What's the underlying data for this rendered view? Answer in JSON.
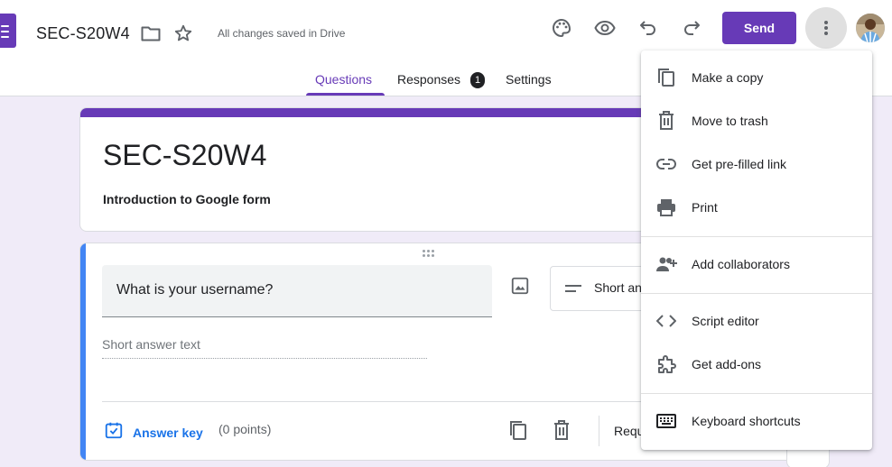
{
  "header": {
    "doc_title": "SEC-S20W4",
    "save_status": "All changes saved in Drive",
    "send_label": "Send",
    "icons": [
      "forms-logo-icon",
      "folder-icon",
      "star-icon",
      "palette-icon",
      "preview-eye-icon",
      "undo-icon",
      "redo-icon",
      "more-vert-icon",
      "avatar"
    ]
  },
  "tabs": {
    "questions": "Questions",
    "responses": "Responses",
    "responses_badge": "1",
    "settings": "Settings",
    "active": "Questions"
  },
  "form": {
    "title": "SEC-S20W4",
    "description": "Introduction to Google form"
  },
  "question": {
    "text": "What is your username?",
    "type": "Short answer",
    "answer_placeholder": "Short answer text",
    "answer_key_label": "Answer key",
    "points": "(0 points)",
    "required_label": "Required"
  },
  "menu": {
    "items": [
      {
        "label": "Make a copy",
        "icon": "copy-icon"
      },
      {
        "label": "Move to trash",
        "icon": "trash-icon"
      },
      {
        "label": "Get pre-filled link",
        "icon": "link-icon"
      },
      {
        "label": "Print",
        "icon": "print-icon"
      },
      {
        "label": "Add collaborators",
        "icon": "add-people-icon"
      },
      {
        "label": "Script editor",
        "icon": "code-icon"
      },
      {
        "label": "Get add-ons",
        "icon": "puzzle-icon"
      },
      {
        "label": "Keyboard shortcuts",
        "icon": "keyboard-icon"
      }
    ]
  },
  "colors": {
    "brand": "#673ab7",
    "question_accent": "#4285f4",
    "link": "#1a73e8",
    "background": "#f0ebf8"
  }
}
